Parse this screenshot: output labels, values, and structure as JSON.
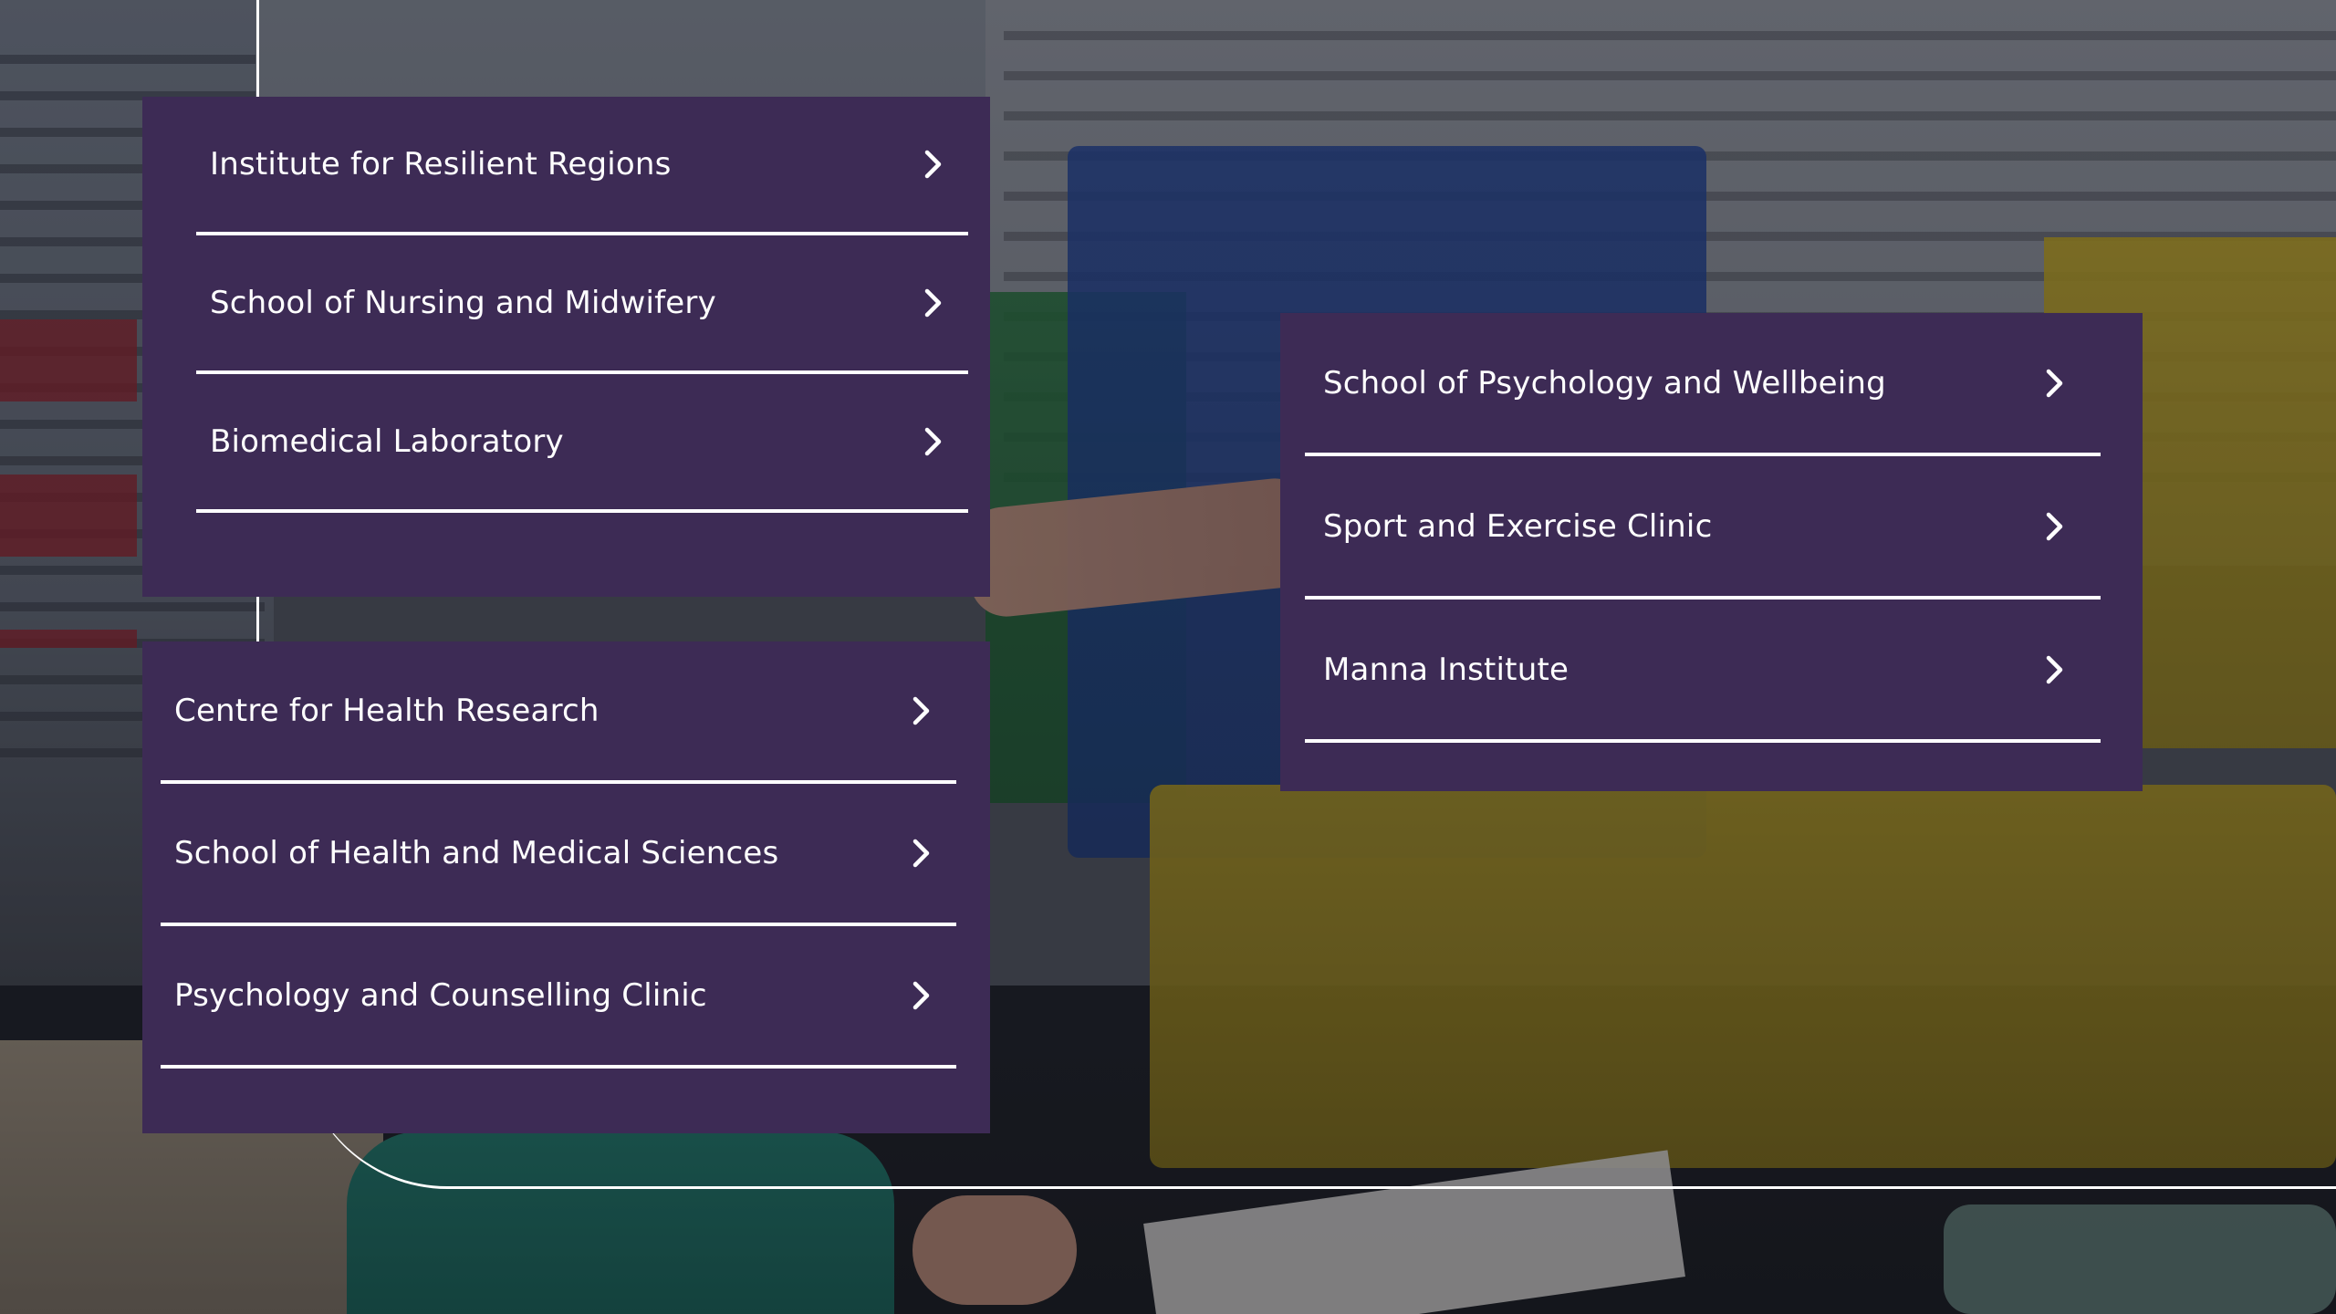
{
  "panels": [
    {
      "id": "panel-left-top",
      "links": [
        {
          "label": "Institute for Resilient Regions",
          "icon": "chevron-right-icon"
        },
        {
          "label": "School of Nursing and Midwifery",
          "icon": "chevron-right-icon"
        },
        {
          "label": "Biomedical Laboratory",
          "icon": "chevron-right-icon"
        }
      ]
    },
    {
      "id": "panel-left-bottom",
      "links": [
        {
          "label": "Centre for Health Research",
          "icon": "chevron-right-icon"
        },
        {
          "label": "School of Health and Medical Sciences",
          "icon": "chevron-right-icon"
        },
        {
          "label": "Psychology and Counselling Clinic",
          "icon": "chevron-right-icon"
        }
      ]
    },
    {
      "id": "panel-right",
      "links": [
        {
          "label": "School of Psychology and Wellbeing",
          "icon": "chevron-right-icon"
        },
        {
          "label": "Sport and Exercise Clinic",
          "icon": "chevron-right-icon"
        },
        {
          "label": "Manna Institute",
          "icon": "chevron-right-icon"
        }
      ]
    }
  ],
  "colors": {
    "panel_background": "#3d2b55",
    "text": "#ffffff",
    "divider": "#ffffff",
    "decorative_line": "#ffffff"
  }
}
